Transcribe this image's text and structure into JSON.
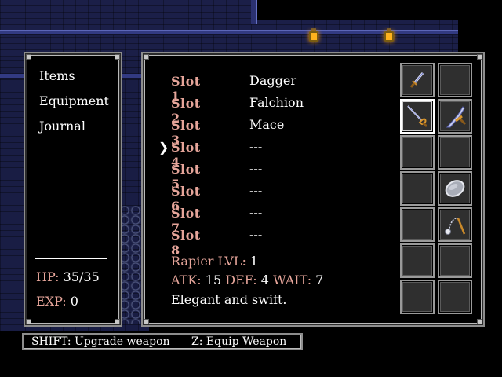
{
  "menu": {
    "items": [
      {
        "label": "Items"
      },
      {
        "label": "Equipment"
      },
      {
        "label": "Journal"
      }
    ]
  },
  "stats": {
    "hp_label": "HP:",
    "hp_value": "35/35",
    "exp_label": "EXP:",
    "exp_value": "0"
  },
  "slots": [
    {
      "label": "Slot 1",
      "weapon": "Dagger"
    },
    {
      "label": "Slot 2",
      "weapon": "Falchion"
    },
    {
      "label": "Slot 3",
      "weapon": "Mace"
    },
    {
      "label": "Slot 4",
      "weapon": "---"
    },
    {
      "label": "Slot 5",
      "weapon": "---"
    },
    {
      "label": "Slot 6",
      "weapon": "---"
    },
    {
      "label": "Slot 7",
      "weapon": "---"
    },
    {
      "label": "Slot 8",
      "weapon": "---"
    }
  ],
  "cursor": {
    "glyph": "❯",
    "selected_slot": 4
  },
  "details": {
    "weapon_name": "Rapier",
    "lvl_label": "LVL:",
    "lvl_value": "1",
    "atk_label": "ATK:",
    "atk_value": "15",
    "def_label": "DEF:",
    "def_value": "4",
    "wait_label": "WAIT:",
    "wait_value": "7",
    "description": "Elegant and swift."
  },
  "inventory_grid": {
    "cells": [
      {
        "icon": "dagger-icon"
      },
      {
        "icon": "empty"
      },
      {
        "icon": "rapier-icon",
        "selected": true
      },
      {
        "icon": "falchion-icon"
      },
      {
        "icon": "empty"
      },
      {
        "icon": "empty"
      },
      {
        "icon": "empty"
      },
      {
        "icon": "shield-icon"
      },
      {
        "icon": "empty"
      },
      {
        "icon": "flail-icon"
      },
      {
        "icon": "empty"
      },
      {
        "icon": "empty"
      },
      {
        "icon": "empty"
      },
      {
        "icon": "empty"
      }
    ]
  },
  "hints": {
    "upgrade": "SHIFT: Upgrade weapon",
    "equip": "Z: Equip Weapon"
  },
  "colors": {
    "accent": "#e6a59a",
    "text": "#ffffff",
    "panel_border": "#8d8d8d",
    "lantern": "#ffb21e"
  }
}
